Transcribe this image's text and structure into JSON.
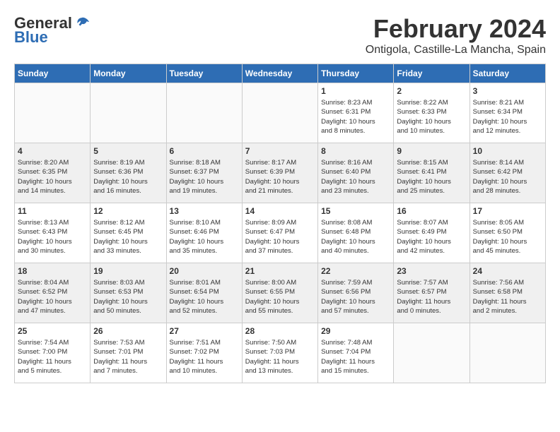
{
  "logo": {
    "general": "General",
    "blue": "Blue"
  },
  "title": {
    "month": "February 2024",
    "location": "Ontigola, Castille-La Mancha, Spain"
  },
  "days_of_week": [
    "Sunday",
    "Monday",
    "Tuesday",
    "Wednesday",
    "Thursday",
    "Friday",
    "Saturday"
  ],
  "weeks": [
    [
      {
        "day": "",
        "info": ""
      },
      {
        "day": "",
        "info": ""
      },
      {
        "day": "",
        "info": ""
      },
      {
        "day": "",
        "info": ""
      },
      {
        "day": "1",
        "info": "Sunrise: 8:23 AM\nSunset: 6:31 PM\nDaylight: 10 hours\nand 8 minutes."
      },
      {
        "day": "2",
        "info": "Sunrise: 8:22 AM\nSunset: 6:33 PM\nDaylight: 10 hours\nand 10 minutes."
      },
      {
        "day": "3",
        "info": "Sunrise: 8:21 AM\nSunset: 6:34 PM\nDaylight: 10 hours\nand 12 minutes."
      }
    ],
    [
      {
        "day": "4",
        "info": "Sunrise: 8:20 AM\nSunset: 6:35 PM\nDaylight: 10 hours\nand 14 minutes."
      },
      {
        "day": "5",
        "info": "Sunrise: 8:19 AM\nSunset: 6:36 PM\nDaylight: 10 hours\nand 16 minutes."
      },
      {
        "day": "6",
        "info": "Sunrise: 8:18 AM\nSunset: 6:37 PM\nDaylight: 10 hours\nand 19 minutes."
      },
      {
        "day": "7",
        "info": "Sunrise: 8:17 AM\nSunset: 6:39 PM\nDaylight: 10 hours\nand 21 minutes."
      },
      {
        "day": "8",
        "info": "Sunrise: 8:16 AM\nSunset: 6:40 PM\nDaylight: 10 hours\nand 23 minutes."
      },
      {
        "day": "9",
        "info": "Sunrise: 8:15 AM\nSunset: 6:41 PM\nDaylight: 10 hours\nand 25 minutes."
      },
      {
        "day": "10",
        "info": "Sunrise: 8:14 AM\nSunset: 6:42 PM\nDaylight: 10 hours\nand 28 minutes."
      }
    ],
    [
      {
        "day": "11",
        "info": "Sunrise: 8:13 AM\nSunset: 6:43 PM\nDaylight: 10 hours\nand 30 minutes."
      },
      {
        "day": "12",
        "info": "Sunrise: 8:12 AM\nSunset: 6:45 PM\nDaylight: 10 hours\nand 33 minutes."
      },
      {
        "day": "13",
        "info": "Sunrise: 8:10 AM\nSunset: 6:46 PM\nDaylight: 10 hours\nand 35 minutes."
      },
      {
        "day": "14",
        "info": "Sunrise: 8:09 AM\nSunset: 6:47 PM\nDaylight: 10 hours\nand 37 minutes."
      },
      {
        "day": "15",
        "info": "Sunrise: 8:08 AM\nSunset: 6:48 PM\nDaylight: 10 hours\nand 40 minutes."
      },
      {
        "day": "16",
        "info": "Sunrise: 8:07 AM\nSunset: 6:49 PM\nDaylight: 10 hours\nand 42 minutes."
      },
      {
        "day": "17",
        "info": "Sunrise: 8:05 AM\nSunset: 6:50 PM\nDaylight: 10 hours\nand 45 minutes."
      }
    ],
    [
      {
        "day": "18",
        "info": "Sunrise: 8:04 AM\nSunset: 6:52 PM\nDaylight: 10 hours\nand 47 minutes."
      },
      {
        "day": "19",
        "info": "Sunrise: 8:03 AM\nSunset: 6:53 PM\nDaylight: 10 hours\nand 50 minutes."
      },
      {
        "day": "20",
        "info": "Sunrise: 8:01 AM\nSunset: 6:54 PM\nDaylight: 10 hours\nand 52 minutes."
      },
      {
        "day": "21",
        "info": "Sunrise: 8:00 AM\nSunset: 6:55 PM\nDaylight: 10 hours\nand 55 minutes."
      },
      {
        "day": "22",
        "info": "Sunrise: 7:59 AM\nSunset: 6:56 PM\nDaylight: 10 hours\nand 57 minutes."
      },
      {
        "day": "23",
        "info": "Sunrise: 7:57 AM\nSunset: 6:57 PM\nDaylight: 11 hours\nand 0 minutes."
      },
      {
        "day": "24",
        "info": "Sunrise: 7:56 AM\nSunset: 6:58 PM\nDaylight: 11 hours\nand 2 minutes."
      }
    ],
    [
      {
        "day": "25",
        "info": "Sunrise: 7:54 AM\nSunset: 7:00 PM\nDaylight: 11 hours\nand 5 minutes."
      },
      {
        "day": "26",
        "info": "Sunrise: 7:53 AM\nSunset: 7:01 PM\nDaylight: 11 hours\nand 7 minutes."
      },
      {
        "day": "27",
        "info": "Sunrise: 7:51 AM\nSunset: 7:02 PM\nDaylight: 11 hours\nand 10 minutes."
      },
      {
        "day": "28",
        "info": "Sunrise: 7:50 AM\nSunset: 7:03 PM\nDaylight: 11 hours\nand 13 minutes."
      },
      {
        "day": "29",
        "info": "Sunrise: 7:48 AM\nSunset: 7:04 PM\nDaylight: 11 hours\nand 15 minutes."
      },
      {
        "day": "",
        "info": ""
      },
      {
        "day": "",
        "info": ""
      }
    ]
  ]
}
